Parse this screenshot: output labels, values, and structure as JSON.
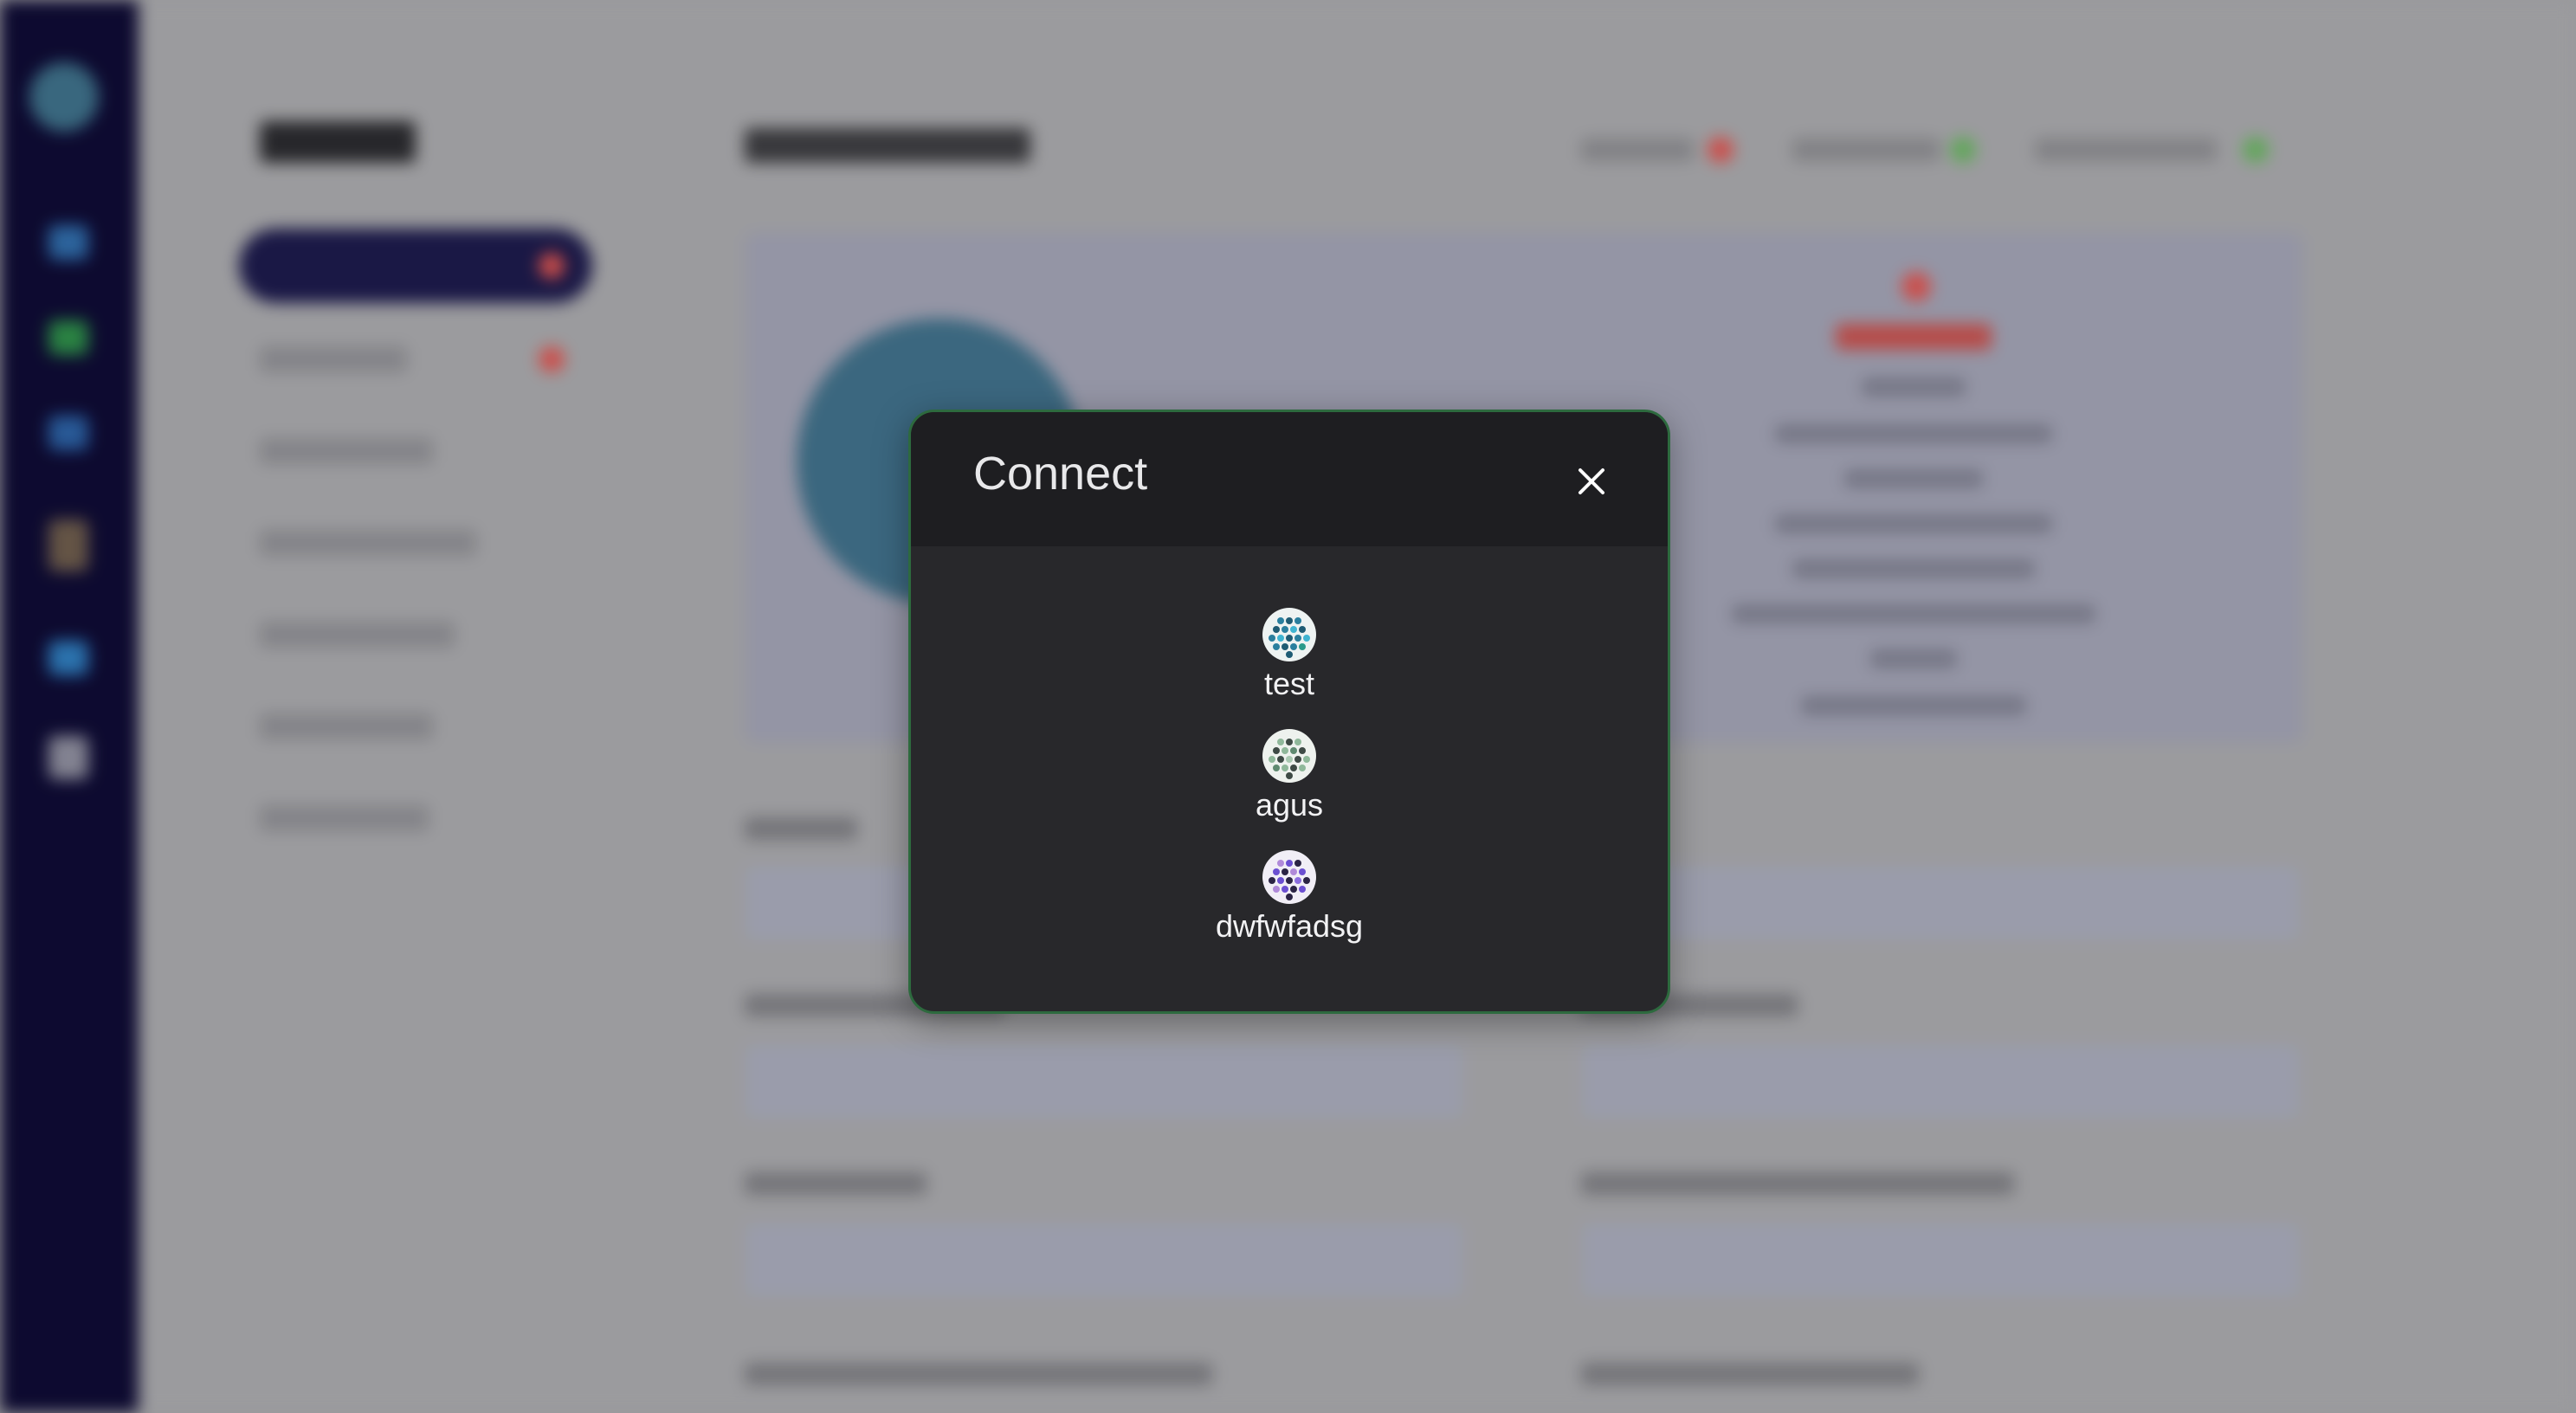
{
  "modal": {
    "title": "Connect",
    "close_icon": "close-icon",
    "accounts": [
      {
        "name": "test",
        "avatar_icon": "dotted-avatar-icon"
      },
      {
        "name": "agus",
        "avatar_icon": "dotted-avatar-icon"
      },
      {
        "name": "dwfwfadsg",
        "avatar_icon": "dotted-avatar-icon"
      }
    ]
  },
  "colors": {
    "modal_bg": "#28282b",
    "modal_header_bg": "#1e1e21",
    "modal_border": "#2d6a3e",
    "sidebar_bg": "#0e0b33",
    "backdrop": "#a5a5a8"
  }
}
